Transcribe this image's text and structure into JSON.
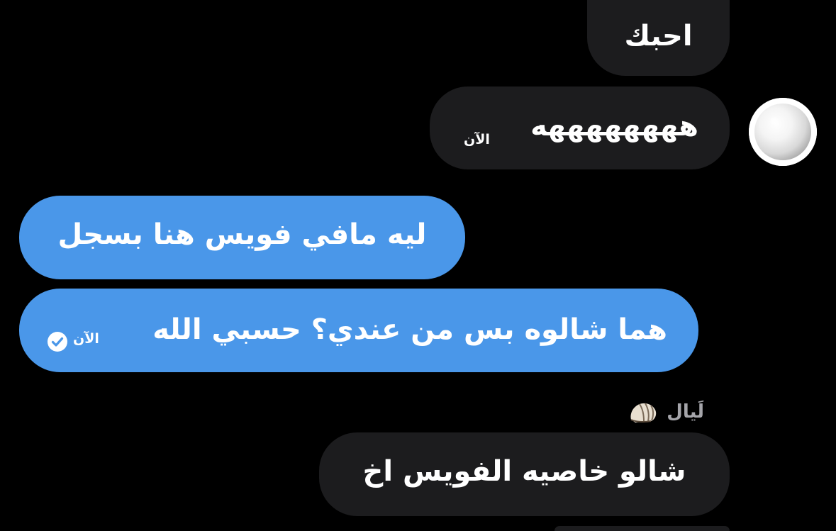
{
  "messages": [
    {
      "id": "m1",
      "direction": "incoming",
      "text": "احبك"
    },
    {
      "id": "m2",
      "direction": "incoming",
      "text": "ههههههههه",
      "time": "الآن"
    },
    {
      "id": "m3",
      "direction": "outgoing",
      "text": "ليه مافي فويس هنا بسجل"
    },
    {
      "id": "m4",
      "direction": "outgoing",
      "text": "هما شالوه بس من عندي؟ حسبي الله",
      "time": "الآن",
      "status": "read"
    },
    {
      "id": "m5",
      "direction": "incoming",
      "sender": "لَيال",
      "sender_icon": "shell-icon",
      "text": "شالو خاصيه الفويس اخ"
    }
  ],
  "avatar_icon": "pearl-avatar",
  "status_icon": "check-circle-icon",
  "colors": {
    "background": "#000000",
    "incoming_bubble": "#1c1c1e",
    "outgoing_bubble": "#4a97e9",
    "text": "#ffffff",
    "sender_name": "#a5a5aa"
  }
}
